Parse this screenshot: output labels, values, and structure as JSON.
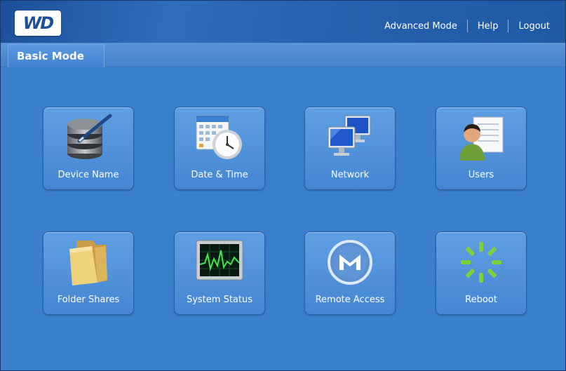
{
  "header": {
    "logo_text": "WD",
    "nav": {
      "advanced_mode": "Advanced Mode",
      "help": "Help",
      "logout": "Logout"
    }
  },
  "tab": {
    "label": "Basic Mode"
  },
  "tiles": [
    {
      "label": "Device Name",
      "icon": "database-pen-icon"
    },
    {
      "label": "Date & Time",
      "icon": "calendar-clock-icon"
    },
    {
      "label": "Network",
      "icon": "network-monitors-icon"
    },
    {
      "label": "Users",
      "icon": "user-icon"
    },
    {
      "label": "Folder Shares",
      "icon": "folder-icon"
    },
    {
      "label": "System Status",
      "icon": "monitor-graph-icon"
    },
    {
      "label": "Remote Access",
      "icon": "remote-access-m-icon"
    },
    {
      "label": "Reboot",
      "icon": "reboot-spinner-icon"
    }
  ],
  "colors": {
    "background": "#3a80cd",
    "header": "#1d4f98",
    "tile": "#4f92dc",
    "reboot_green": "#7fd13b"
  }
}
